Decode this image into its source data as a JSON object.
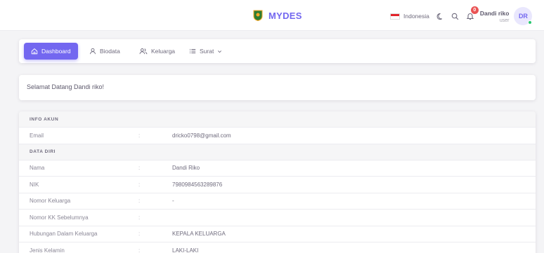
{
  "brand": {
    "name": "MYDES"
  },
  "topbar": {
    "language": "Indonesia",
    "notification_count": "0",
    "user_name": "Dandi riko",
    "user_role": "user",
    "avatar_initials": "DR"
  },
  "menu": {
    "items": [
      {
        "label": "Dashboard",
        "icon": "home-icon"
      },
      {
        "label": "Biodata",
        "icon": "user-icon"
      },
      {
        "label": "Keluarga",
        "icon": "users-icon"
      },
      {
        "label": "Surat",
        "icon": "list-icon"
      }
    ]
  },
  "welcome": {
    "text": "Selamat Datang Dandi riko!"
  },
  "info": {
    "sections": [
      {
        "title": "INFO AKUN"
      },
      {
        "title": "DATA DIRI"
      }
    ],
    "separator": ":",
    "rows": [
      {
        "label": "Email",
        "value": "dricko0798@gmail.com"
      },
      {
        "label": "Nama",
        "value": "Dandi Riko"
      },
      {
        "label": "NIK",
        "value": "7980984563289876"
      },
      {
        "label": "Nomor Keluarga",
        "value": "-"
      },
      {
        "label": "Nomor KK Sebelumnya",
        "value": ""
      },
      {
        "label": "Hubungan Dalam Keluarga",
        "value": "KEPALA KELUARGA"
      },
      {
        "label": "Jenis Kelamin",
        "value": "LAKI-LAKI"
      }
    ]
  },
  "colors": {
    "primary": "#7367f0",
    "danger": "#ea5455",
    "success": "#28c76f"
  }
}
